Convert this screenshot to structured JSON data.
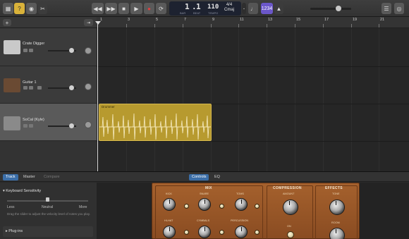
{
  "control_bar": {
    "lcd": {
      "bar": "1",
      "beat": "1",
      "bar_label": "BAR",
      "beat_label": "BEAT",
      "tempo": "110",
      "tempo_label": "TEMPO",
      "signature": "4/4",
      "key": "Cmaj"
    },
    "count_in": "1234"
  },
  "tracks": [
    {
      "name": "Crate Digger"
    },
    {
      "name": "Guitar 1"
    },
    {
      "name": "SoCal (Kyle)"
    }
  ],
  "ruler": {
    "bars": [
      "1",
      "3",
      "5",
      "7",
      "9",
      "11",
      "13",
      "15",
      "17",
      "19",
      "21"
    ]
  },
  "region": {
    "title": "Drummer"
  },
  "lower": {
    "left_tabs": [
      "Track",
      "Master",
      "Compare"
    ],
    "editor_tabs": [
      "Controls",
      "EQ"
    ]
  },
  "inspector": {
    "section_title": "Keyboard Sensitivity",
    "description": "Drag the slider to adjust the velocity level of notes you play.",
    "less": "Less",
    "neutral": "Neutral",
    "more": "More",
    "plugins_title": "Plug-ins"
  },
  "kit": {
    "mix_title": "MIX",
    "compression_title": "COMPRESSION",
    "effects_title": "EFFECTS",
    "labels": {
      "kick": "KICK",
      "snare": "SNARE",
      "toms": "TOMS",
      "amount": "AMOUNT",
      "tone": "TONE",
      "hihat": "HI-HAT",
      "cymbals": "CYMBALS",
      "percussion": "PERCUSSION",
      "on": "ON",
      "room": "ROOM"
    }
  },
  "colors": {
    "region": "#b79a2f",
    "selected_tab": "#3b6ea8",
    "kit_wood": "#9a5627"
  }
}
